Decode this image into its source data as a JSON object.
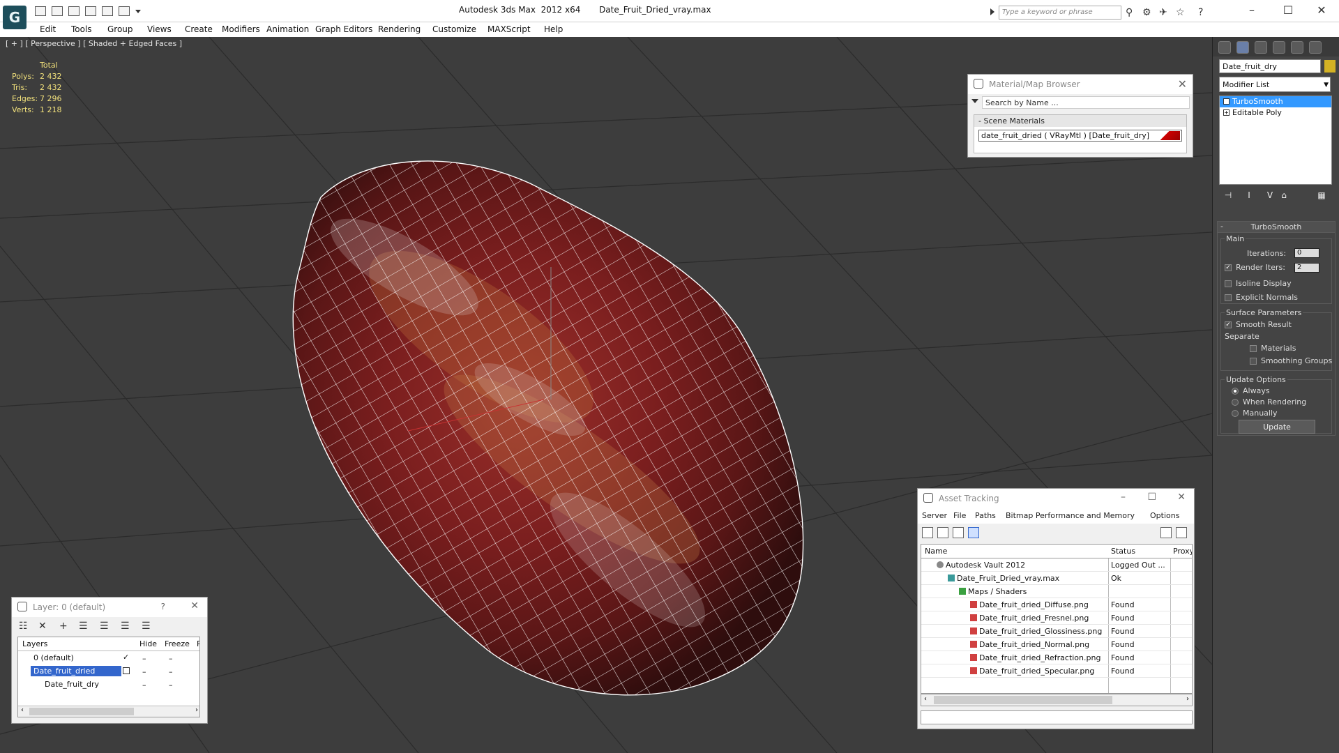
{
  "titlebar": {
    "app_title": "Autodesk 3ds Max  2012 x64",
    "file_name": "Date_Fruit_Dried_vray.max",
    "search_placeholder": "Type a keyword or phrase"
  },
  "menu": [
    "Edit",
    "Tools",
    "Group",
    "Views",
    "Create",
    "Modifiers",
    "Animation",
    "Graph Editors",
    "Rendering",
    "Customize",
    "MAXScript",
    "Help"
  ],
  "viewport": {
    "label": "[ + ] [ Perspective ] [ Shaded + Edged Faces ]",
    "stats": {
      "total_label": "Total",
      "rows": [
        {
          "label": "Polys:",
          "value": "2 432"
        },
        {
          "label": "Tris:",
          "value": "2 432"
        },
        {
          "label": "Edges:",
          "value": "7 296"
        },
        {
          "label": "Verts:",
          "value": "1 218"
        }
      ]
    }
  },
  "material_browser": {
    "title": "Material/Map Browser",
    "search": "Search by Name ...",
    "section": "Scene Materials",
    "item": "date_fruit_dried  ( VRayMtl )  [Date_fruit_dry]"
  },
  "asset_tracking": {
    "title": "Asset Tracking",
    "menu": [
      "Server",
      "File",
      "Paths",
      "Bitmap Performance and Memory",
      "Options"
    ],
    "columns": {
      "name": "Name",
      "status": "Status",
      "proxy": "Proxy"
    },
    "rows": [
      {
        "name": "Autodesk Vault 2012",
        "status": "Logged Out ...",
        "indent": 0,
        "icon": "vault-icon"
      },
      {
        "name": "Date_Fruit_Dried_vray.max",
        "status": "Ok",
        "indent": 1,
        "icon": "max-file-icon"
      },
      {
        "name": "Maps / Shaders",
        "status": "",
        "indent": 2,
        "icon": "folder-icon"
      },
      {
        "name": "Date_fruit_dried_Diffuse.png",
        "status": "Found",
        "indent": 3,
        "icon": "png-icon"
      },
      {
        "name": "Date_fruit_dried_Fresnel.png",
        "status": "Found",
        "indent": 3,
        "icon": "png-icon"
      },
      {
        "name": "Date_fruit_dried_Glossiness.png",
        "status": "Found",
        "indent": 3,
        "icon": "png-icon"
      },
      {
        "name": "Date_fruit_dried_Normal.png",
        "status": "Found",
        "indent": 3,
        "icon": "png-icon"
      },
      {
        "name": "Date_fruit_dried_Refraction.png",
        "status": "Found",
        "indent": 3,
        "icon": "png-icon"
      },
      {
        "name": "Date_fruit_dried_Specular.png",
        "status": "Found",
        "indent": 3,
        "icon": "png-icon"
      }
    ]
  },
  "layer_panel": {
    "title": "Layer: 0 (default)",
    "help": "?",
    "columns": {
      "layers": "Layers",
      "hide": "Hide",
      "freeze": "Freeze",
      "render": "R"
    },
    "rows": [
      {
        "name": "0 (default)",
        "indent": 1,
        "selected": false
      },
      {
        "name": "Date_fruit_dried",
        "indent": 1,
        "selected": true
      },
      {
        "name": "Date_fruit_dry",
        "indent": 2,
        "selected": false
      }
    ]
  },
  "command_panel": {
    "object_name": "Date_fruit_dry",
    "object_color": "#d4b224",
    "modifier_list": "Modifier List",
    "stack": [
      {
        "name": "TurboSmooth",
        "selected": true
      },
      {
        "name": "Editable Poly",
        "selected": false
      }
    ],
    "turbosmooth": {
      "title": "TurboSmooth",
      "main": "Main",
      "iterations_label": "Iterations:",
      "iterations": "0",
      "render_iters_label": "Render Iters:",
      "render_iters": "2",
      "isoline": "Isoline Display",
      "explicit": "Explicit Normals",
      "surface": "Surface Parameters",
      "smooth_result": "Smooth Result",
      "separate": "Separate",
      "materials": "Materials",
      "smoothing_groups": "Smoothing Groups",
      "update_options": "Update Options",
      "always": "Always",
      "when_rendering": "When Rendering",
      "manually": "Manually",
      "update": "Update"
    }
  }
}
